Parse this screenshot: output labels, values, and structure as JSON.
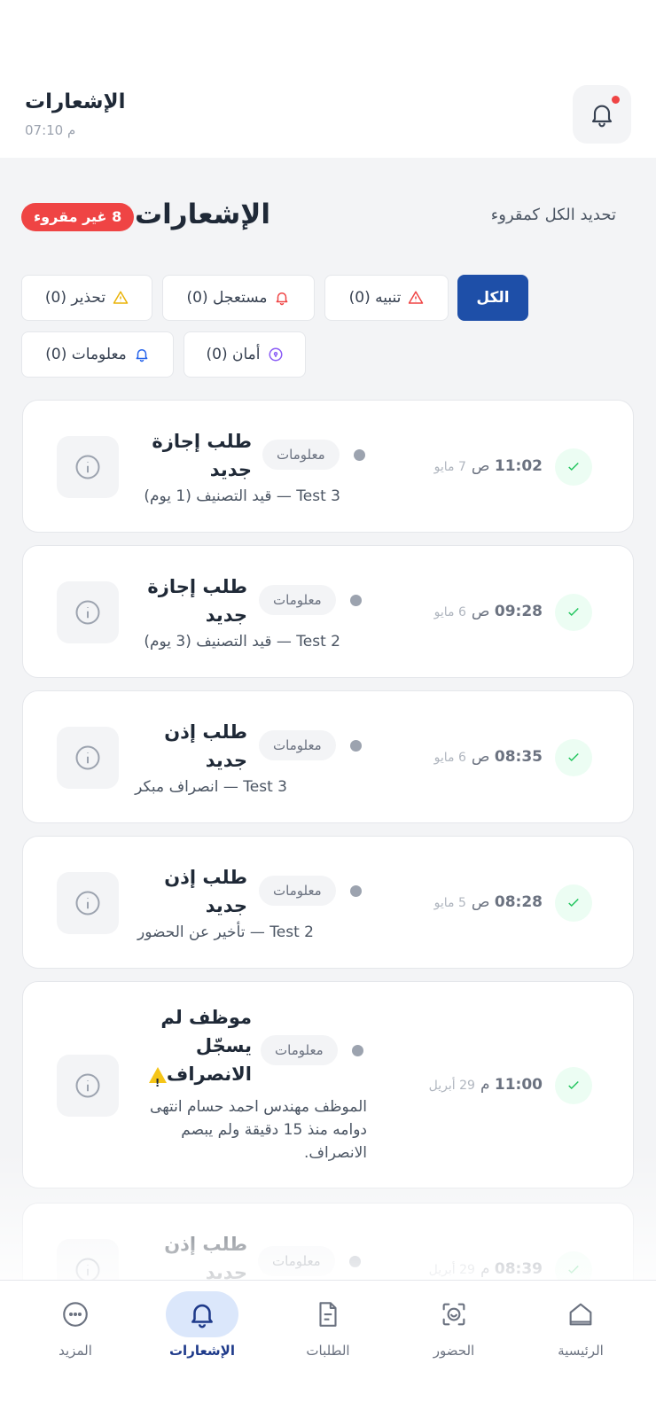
{
  "header": {
    "title": "الإشعارات",
    "time": "07:10 م"
  },
  "section": {
    "mark_all": "تحديد الكل كمقروء",
    "title": "الإشعارات",
    "unread_badge": "8 غير مقروء"
  },
  "filters": [
    {
      "label": "الكل",
      "icon": "none",
      "active": true
    },
    {
      "label": "تنبيه (0)",
      "icon": "alert-triangle-icon",
      "color": "#ef4444"
    },
    {
      "label": "مستعجل (0)",
      "icon": "bell-icon",
      "color": "#ef4444"
    },
    {
      "label": "تحذير (0)",
      "icon": "warning-triangle-icon",
      "color": "#eab308"
    },
    {
      "label": "أمان (0)",
      "icon": "shield-icon",
      "color": "#8b5cf6"
    },
    {
      "label": "معلومات (0)",
      "icon": "bell-icon",
      "color": "#2563eb"
    }
  ],
  "notifications": [
    {
      "title1": "طلب إجازة",
      "title2": "جديد",
      "category": "معلومات",
      "time": "11:02",
      "ampm": "ص",
      "date": "7 مايو",
      "body": "Test 3 — قيد التصنيف (1 يوم)"
    },
    {
      "title1": "طلب إجازة",
      "title2": "جديد",
      "category": "معلومات",
      "time": "09:28",
      "ampm": "ص",
      "date": "6 مايو",
      "body": "Test 2 — قيد التصنيف (3 يوم)"
    },
    {
      "title1": "طلب إذن",
      "title2": "جديد",
      "category": "معلومات",
      "time": "08:35",
      "ampm": "ص",
      "date": "6 مايو",
      "body": "Test 3 — انصراف مبكر"
    },
    {
      "title1": "طلب إذن",
      "title2": "جديد",
      "category": "معلومات",
      "time": "08:28",
      "ampm": "ص",
      "date": "5 مايو",
      "body": "Test 2 — تأخير عن الحضور"
    },
    {
      "title1": "موظف لم",
      "title2": "يسجّل",
      "title3": "الانصراف",
      "category": "معلومات",
      "time": "11:00",
      "ampm": "م",
      "date": "29 أبريل",
      "body1": "الموظف مهندس احمد حسام انتهى",
      "body2": "دوامه منذ 15 دقيقة ولم يبصم",
      "body3": "الانصراف."
    },
    {
      "title1": "طلب إذن",
      "title2": "جديد",
      "category": "معلومات",
      "time": "08:39",
      "ampm": "م",
      "date": "29 أبريل"
    }
  ],
  "nav": [
    {
      "label": "الرئيسية",
      "icon": "home-icon"
    },
    {
      "label": "الحضور",
      "icon": "face-scan-icon"
    },
    {
      "label": "الطلبات",
      "icon": "document-icon"
    },
    {
      "label": "الإشعارات",
      "icon": "bell-icon",
      "active": true
    },
    {
      "label": "المزيد",
      "icon": "more-icon"
    }
  ]
}
